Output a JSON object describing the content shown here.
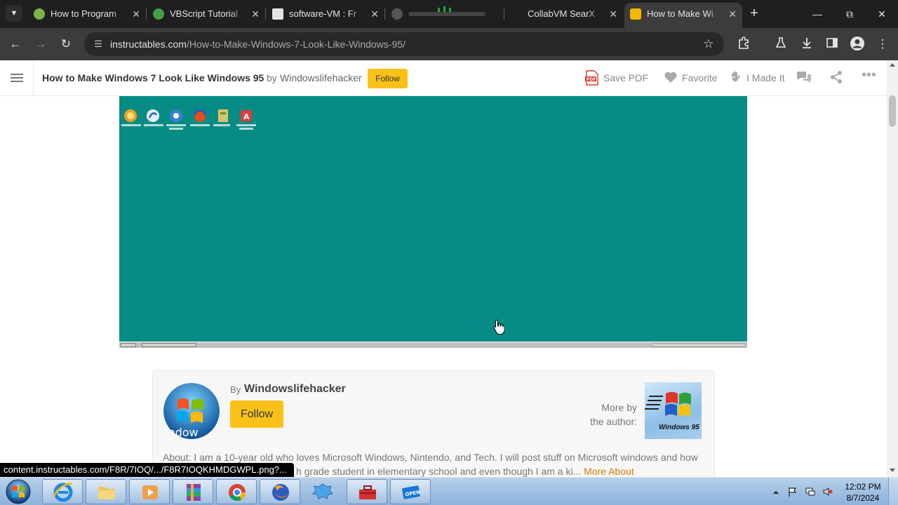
{
  "browser": {
    "tabs": [
      {
        "title": "How to Program",
        "active": false
      },
      {
        "title": "VBScript Tutorial",
        "active": false
      },
      {
        "title": "software-VM : Fr",
        "active": false
      },
      {
        "title": "",
        "active": false
      },
      {
        "title": "CollabVM SearX",
        "active": false
      },
      {
        "title": "How to Make Wi",
        "active": true
      }
    ],
    "url_host": "instructables.com",
    "url_path": "/How-to-Make-Windows-7-Look-Like-Windows-95/"
  },
  "site_header": {
    "title": "How to Make Windows 7 Look Like Windows 95",
    "by": "by",
    "author": "Windowslifehacker",
    "follow": "Follow",
    "actions": {
      "save_pdf": "Save PDF",
      "favorite": "Favorite",
      "made_it": "I Made It"
    }
  },
  "author_card": {
    "by": "By",
    "name": "Windowslifehacker",
    "follow": "Follow",
    "more_by_line1": "More by",
    "more_by_line2": "the author:",
    "thumb_text": "Windows 95",
    "about": "About: I am a 10-year old who loves Microsoft Windows, Nintendo, and Tech. I will post stuff on Microsoft windows and how",
    "about_line2": "h grade student in elementary school and even though I am a ki...",
    "more_about": "More About"
  },
  "status_bar": {
    "url": "content.instructables.com/F8R/7IOQ/.../F8R7IOQKHMDGWPL.png?..."
  },
  "taskbar": {
    "time": "12:02 PM",
    "date": "8/7/2024"
  },
  "colors": {
    "accent_yellow": "#fac219",
    "teal_desktop": "#068c84",
    "chrome_dark": "#1f1f1f"
  }
}
